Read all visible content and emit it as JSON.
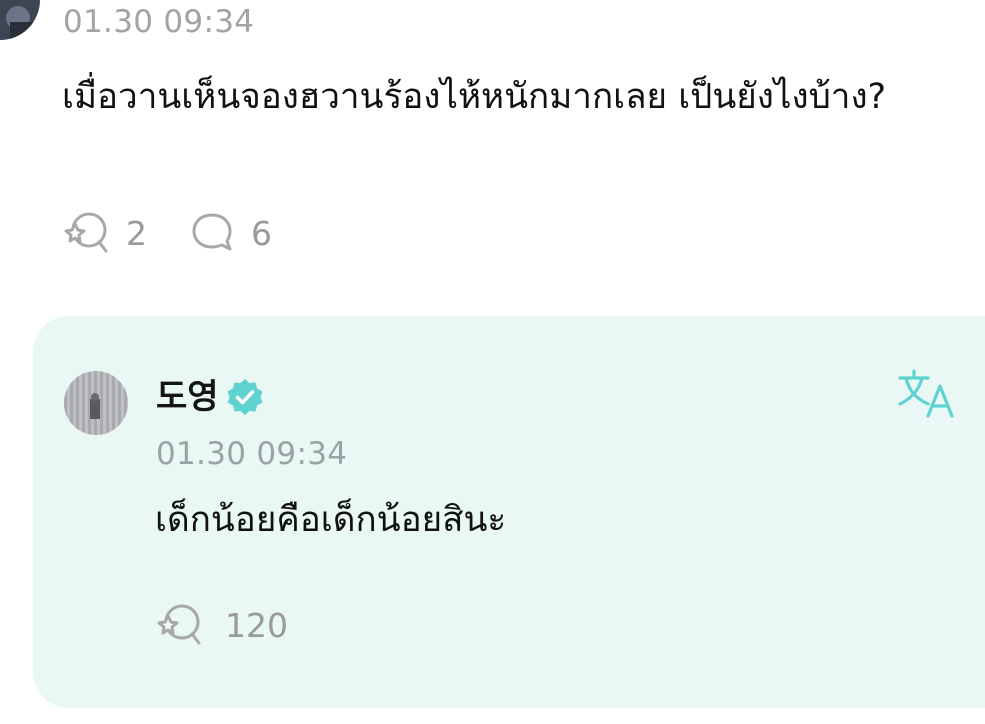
{
  "top_comment": {
    "timestamp": "01.30 09:34",
    "text": "เมื่อวานเห็นจองฮวานร้องไห้หนักมากเลย เป็นยังไงบ้าง?",
    "like_count": "2",
    "comment_count": "6",
    "like_icon": "cheer-icon",
    "comment_icon": "speech-bubble-icon"
  },
  "reply": {
    "author_name": "도영",
    "verified_icon": "verified-badge-icon",
    "translate_icon": "translate-icon",
    "timestamp": "01.30 09:34",
    "text": "เด็กน้อยคือเด็กน้อยสินะ",
    "like_count": "120",
    "like_icon": "cheer-icon"
  },
  "colors": {
    "accent": "#5fd3d0",
    "card_background": "#e9f8f5",
    "muted_text": "#9a9a9a"
  }
}
